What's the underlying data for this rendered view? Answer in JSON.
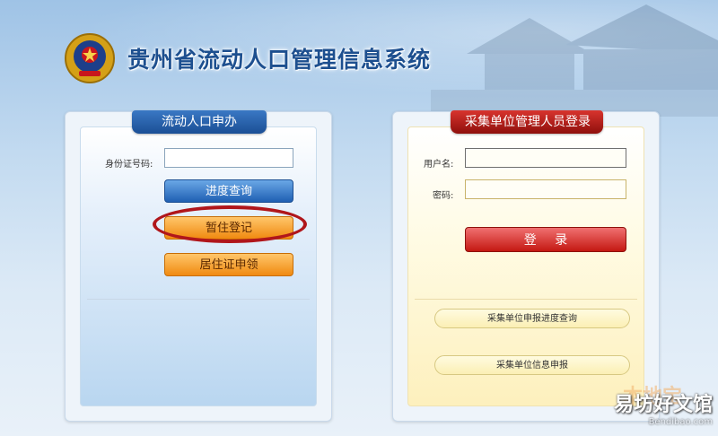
{
  "header": {
    "title": "贵州省流动人口管理信息系统"
  },
  "left_panel": {
    "tab_label": "流动人口申办",
    "id_label": "身份证号码:",
    "id_value": "",
    "buttons": {
      "progress_query": "进度查询",
      "temp_registration": "暂住登记",
      "residence_permit": "居住证申领"
    }
  },
  "right_panel": {
    "tab_label": "采集单位管理人员登录",
    "username_label": "用户名:",
    "username_value": "",
    "password_label": "密码:",
    "password_value": "",
    "login_button": "登 录",
    "links": {
      "progress_query": "采集单位申报进度查询",
      "info_report": "采集单位信息申报"
    }
  },
  "watermark": {
    "main": "易坊好文馆",
    "sub": "Bendibao.com",
    "ghost": "本地宝"
  },
  "colors": {
    "title": "#1d4f8f",
    "tab_blue": "#1b4f95",
    "tab_red": "#8f0f0c",
    "highlight_ellipse": "#b0161b"
  }
}
